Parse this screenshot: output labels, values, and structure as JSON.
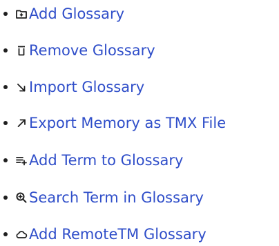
{
  "colors": {
    "link": "#2f4ec9",
    "bullet": "#1f1f1f",
    "icon": "#1f1f1f",
    "background": "#ffffff"
  },
  "menu": {
    "items": [
      {
        "label": "Add Glossary",
        "icon": "folder-plus-icon"
      },
      {
        "label": "Remove Glossary",
        "icon": "trash-icon"
      },
      {
        "label": "Import Glossary",
        "icon": "arrow-down-right-icon"
      },
      {
        "label": "Export Memory as TMX File",
        "icon": "arrow-up-right-icon"
      },
      {
        "label": "Add Term to Glossary",
        "icon": "list-plus-icon"
      },
      {
        "label": "Search Term in Glossary",
        "icon": "zoom-in-icon"
      },
      {
        "label": "Add RemoteTM Glossary",
        "icon": "cloud-icon"
      }
    ]
  }
}
